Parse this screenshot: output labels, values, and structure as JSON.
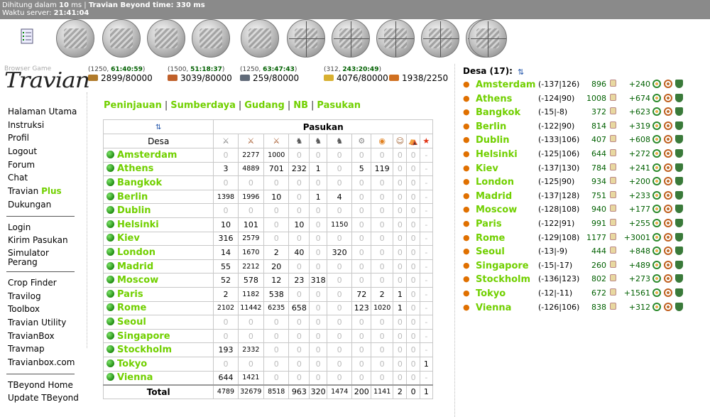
{
  "topbar": {
    "calc_prefix": "Dihitung dalam ",
    "calc_ms": "10",
    "calc_suffix": " ms | ",
    "beyond_time": "Travian Beyond time: 330 ms",
    "server_label": "Waktu server: ",
    "server_time": "21:41:04"
  },
  "logo": {
    "small": "Browser Game",
    "big": "Travian"
  },
  "menu": {
    "group1": [
      "Halaman Utama",
      "Instruksi",
      "Profil",
      "Logout",
      "Forum",
      "Chat"
    ],
    "travian": "Travian ",
    "plus": "Plus",
    "dukungan": "Dukungan",
    "group2": [
      "Login",
      "Kirim Pasukan"
    ],
    "simulator_line1": "Simulator",
    "simulator_line2": "Perang",
    "group3": [
      "Crop Finder",
      "Travilog",
      "Toolbox",
      "Travian Utility",
      "TravianBox",
      "Travmap",
      "Travianbox.com"
    ],
    "group4": [
      "TBeyond Home",
      "Update TBeyond"
    ]
  },
  "resources": [
    {
      "prod": "(1250, ",
      "time": "61:40:59",
      "close": ")",
      "amount": "2899/80000",
      "color": "#b07a2a"
    },
    {
      "prod": "(1500, ",
      "time": "51:18:37",
      "close": ")",
      "amount": "3039/80000",
      "color": "#c0602a"
    },
    {
      "prod": "(1250, ",
      "time": "63:47:43",
      "close": ")",
      "amount": "259/80000",
      "color": "#606a78"
    },
    {
      "prod": "(312, ",
      "time": "243:20:49",
      "close": ")",
      "amount": "4076/80000",
      "color": "#d8b030"
    },
    {
      "prod": "",
      "time": "",
      "close": "",
      "amount": "1938/2250",
      "color": "#d07020"
    }
  ],
  "tabs": [
    "Peninjauan",
    "Sumberdaya",
    "Gudang",
    "NB",
    "Pasukan"
  ],
  "troops": {
    "header_pasukan": "Pasukan",
    "header_desa": "Desa",
    "total_label": "Total",
    "rows": [
      {
        "name": "Amsterdam",
        "vals": [
          "0",
          "2277",
          "1000",
          "0",
          "0",
          "0",
          "0",
          "0",
          "0",
          "0",
          "-"
        ]
      },
      {
        "name": "Athens",
        "vals": [
          "3",
          "4889",
          "701",
          "232",
          "1",
          "0",
          "5",
          "119",
          "0",
          "0",
          "-"
        ]
      },
      {
        "name": "Bangkok",
        "vals": [
          "0",
          "0",
          "0",
          "0",
          "0",
          "0",
          "0",
          "0",
          "0",
          "0",
          "-"
        ]
      },
      {
        "name": "Berlin",
        "vals": [
          "1398",
          "1996",
          "10",
          "0",
          "1",
          "4",
          "0",
          "0",
          "0",
          "0",
          "-"
        ]
      },
      {
        "name": "Dublin",
        "vals": [
          "0",
          "0",
          "0",
          "0",
          "0",
          "0",
          "0",
          "0",
          "0",
          "0",
          "-"
        ]
      },
      {
        "name": "Helsinki",
        "vals": [
          "10",
          "101",
          "0",
          "10",
          "0",
          "1150",
          "0",
          "0",
          "0",
          "0",
          "-"
        ]
      },
      {
        "name": "Kiev",
        "vals": [
          "316",
          "2579",
          "0",
          "0",
          "0",
          "0",
          "0",
          "0",
          "0",
          "0",
          "-"
        ]
      },
      {
        "name": "London",
        "vals": [
          "14",
          "1670",
          "2",
          "40",
          "0",
          "320",
          "0",
          "0",
          "0",
          "0",
          "-"
        ]
      },
      {
        "name": "Madrid",
        "vals": [
          "55",
          "2212",
          "20",
          "0",
          "0",
          "0",
          "0",
          "0",
          "0",
          "0",
          "-"
        ]
      },
      {
        "name": "Moscow",
        "vals": [
          "52",
          "578",
          "12",
          "23",
          "318",
          "0",
          "0",
          "0",
          "0",
          "0",
          "-"
        ]
      },
      {
        "name": "Paris",
        "vals": [
          "2",
          "1182",
          "538",
          "0",
          "0",
          "0",
          "72",
          "2",
          "1",
          "0",
          "-"
        ]
      },
      {
        "name": "Rome",
        "vals": [
          "2102",
          "11442",
          "6235",
          "658",
          "0",
          "0",
          "123",
          "1020",
          "1",
          "0",
          "-"
        ]
      },
      {
        "name": "Seoul",
        "vals": [
          "0",
          "0",
          "0",
          "0",
          "0",
          "0",
          "0",
          "0",
          "0",
          "0",
          "-"
        ]
      },
      {
        "name": "Singapore",
        "vals": [
          "0",
          "0",
          "0",
          "0",
          "0",
          "0",
          "0",
          "0",
          "0",
          "0",
          "-"
        ]
      },
      {
        "name": "Stockholm",
        "vals": [
          "193",
          "2332",
          "0",
          "0",
          "0",
          "0",
          "0",
          "0",
          "0",
          "0",
          "-"
        ]
      },
      {
        "name": "Tokyo",
        "vals": [
          "0",
          "0",
          "0",
          "0",
          "0",
          "0",
          "0",
          "0",
          "0",
          "0",
          "1"
        ]
      },
      {
        "name": "Vienna",
        "vals": [
          "644",
          "1421",
          "0",
          "0",
          "0",
          "0",
          "0",
          "0",
          "0",
          "0",
          "-"
        ]
      }
    ],
    "totals": [
      "4789",
      "32679",
      "8518",
      "963",
      "320",
      "1474",
      "200",
      "1141",
      "2",
      "0",
      "1"
    ],
    "unit_icons": [
      "legionnaire-icon",
      "praetorian-icon",
      "imperian-icon",
      "equites-legati-icon",
      "equites-imperatoris-icon",
      "equites-caesaris-icon",
      "battering-ram-icon",
      "fire-catapult-icon",
      "senator-icon",
      "settler-icon",
      "hero-icon"
    ]
  },
  "villages": {
    "title": "Desa (17):",
    "list": [
      {
        "name": "Amsterdam",
        "coord": "(-137|126)",
        "pop": "896",
        "cp": "+240"
      },
      {
        "name": "Athens",
        "coord": "(-124|90)",
        "pop": "1008",
        "cp": "+674"
      },
      {
        "name": "Bangkok",
        "coord": "(-15|-8)",
        "pop": "372",
        "cp": "+623"
      },
      {
        "name": "Berlin",
        "coord": "(-122|90)",
        "pop": "814",
        "cp": "+319"
      },
      {
        "name": "Dublin",
        "coord": "(-133|106)",
        "pop": "407",
        "cp": "+608"
      },
      {
        "name": "Helsinki",
        "coord": "(-125|106)",
        "pop": "644",
        "cp": "+272"
      },
      {
        "name": "Kiev",
        "coord": "(-137|130)",
        "pop": "784",
        "cp": "+241"
      },
      {
        "name": "London",
        "coord": "(-125|90)",
        "pop": "934",
        "cp": "+200"
      },
      {
        "name": "Madrid",
        "coord": "(-137|128)",
        "pop": "751",
        "cp": "+233"
      },
      {
        "name": "Moscow",
        "coord": "(-128|108)",
        "pop": "940",
        "cp": "+177"
      },
      {
        "name": "Paris",
        "coord": "(-122|91)",
        "pop": "991",
        "cp": "+255"
      },
      {
        "name": "Rome",
        "coord": "(-129|108)",
        "pop": "1177",
        "cp": "+3001"
      },
      {
        "name": "Seoul",
        "coord": "(-13|-9)",
        "pop": "444",
        "cp": "+848"
      },
      {
        "name": "Singapore",
        "coord": "(-15|-17)",
        "pop": "260",
        "cp": "+489"
      },
      {
        "name": "Stockholm",
        "coord": "(-136|123)",
        "pop": "802",
        "cp": "+273"
      },
      {
        "name": "Tokyo",
        "coord": "(-12|-11)",
        "pop": "672",
        "cp": "+1561"
      },
      {
        "name": "Vienna",
        "coord": "(-126|106)",
        "pop": "838",
        "cp": "+312"
      }
    ]
  },
  "nav_icons": [
    "tasks-icon",
    "village-overview-icon",
    "village-center-icon",
    "map-icon",
    "statistics-icon",
    "reports-icon",
    "marketplace-icon",
    "barracks-icon",
    "stable-icon",
    "workshop-icon",
    "rally-point-icon",
    "academy-icon"
  ]
}
